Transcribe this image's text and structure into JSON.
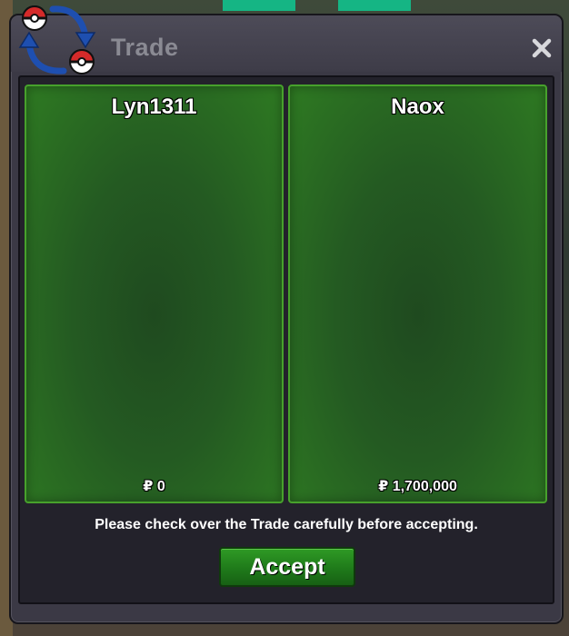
{
  "window": {
    "title": "Trade",
    "logo_icon": "trade-swap-pokeball-icon",
    "close_icon": "close-x-icon"
  },
  "trade": {
    "left": {
      "name": "Lyn1311",
      "money": "₽ 0"
    },
    "right": {
      "name": "Naox",
      "money": "₽ 1,700,000"
    }
  },
  "notice": "Please check over the Trade carefully before accepting.",
  "accept_label": "Accept",
  "colors": {
    "window_bg": "#3b3945",
    "inner_bg": "#23222b",
    "panel_green": "#2e7a22",
    "panel_border": "#47a12c",
    "accept_green": "#1f7a1a",
    "title_text": "#8a8a93"
  }
}
